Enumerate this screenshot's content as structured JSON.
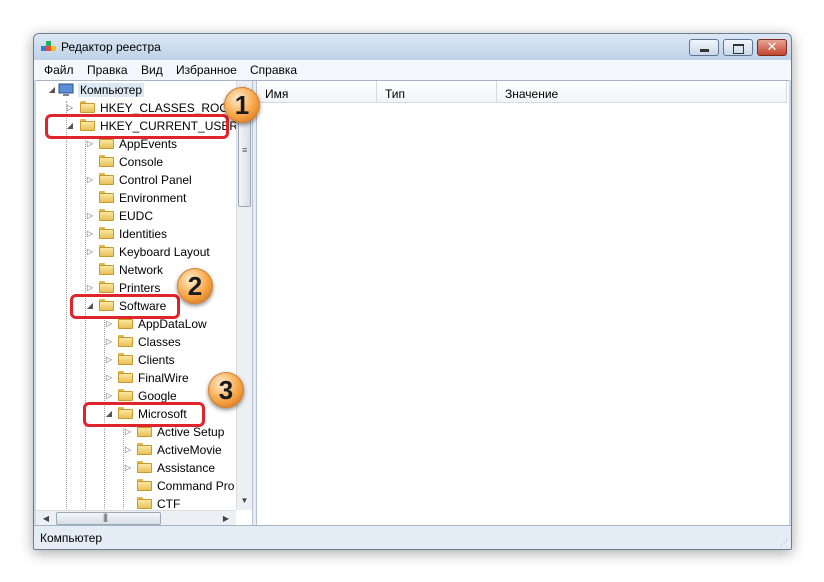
{
  "window": {
    "title": "Редактор реестра"
  },
  "menu": [
    "Файл",
    "Правка",
    "Вид",
    "Избранное",
    "Справка"
  ],
  "columns": {
    "name": "Имя",
    "type": "Тип",
    "value": "Значение"
  },
  "tree": {
    "root": "Компьютер",
    "hkcr": "HKEY_CLASSES_ROOT",
    "hkcu": "HKEY_CURRENT_USER",
    "hkcu_children": [
      "AppEvents",
      "Console",
      "Control Panel",
      "Environment",
      "EUDC",
      "Identities",
      "Keyboard Layout",
      "Network",
      "Printers"
    ],
    "software": "Software",
    "software_children": [
      "AppDataLow",
      "Classes",
      "Clients",
      "FinalWire",
      "Google"
    ],
    "microsoft": "Microsoft",
    "microsoft_children": [
      "Active Setup",
      "ActiveMovie",
      "Assistance",
      "Command Pro",
      "CTF"
    ]
  },
  "status": {
    "path": "Компьютер"
  },
  "badges": [
    "1",
    "2",
    "3"
  ],
  "colors": {
    "highlight": "#e0242c",
    "badge": "#f7a544"
  }
}
